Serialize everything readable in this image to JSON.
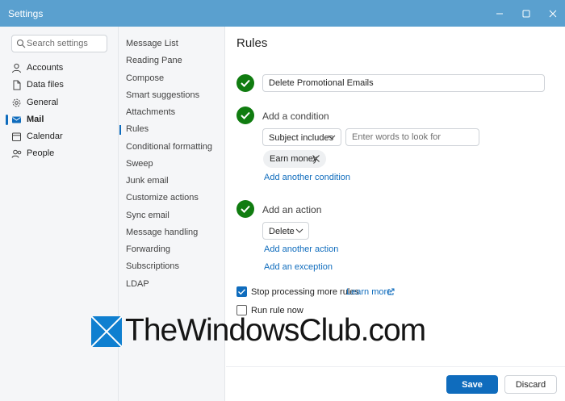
{
  "window": {
    "title": "Settings"
  },
  "search": {
    "placeholder": "Search settings"
  },
  "categories": [
    {
      "label": "Accounts",
      "icon": "person-icon"
    },
    {
      "label": "Data files",
      "icon": "document-icon"
    },
    {
      "label": "General",
      "icon": "gear-icon"
    },
    {
      "label": "Mail",
      "icon": "mail-icon",
      "active": true
    },
    {
      "label": "Calendar",
      "icon": "calendar-icon"
    },
    {
      "label": "People",
      "icon": "people-icon"
    }
  ],
  "mail_sections": [
    {
      "label": "Message List"
    },
    {
      "label": "Reading Pane"
    },
    {
      "label": "Compose"
    },
    {
      "label": "Smart suggestions"
    },
    {
      "label": "Attachments"
    },
    {
      "label": "Rules",
      "active": true
    },
    {
      "label": "Conditional formatting"
    },
    {
      "label": "Sweep"
    },
    {
      "label": "Junk email"
    },
    {
      "label": "Customize actions"
    },
    {
      "label": "Sync email"
    },
    {
      "label": "Message handling"
    },
    {
      "label": "Forwarding"
    },
    {
      "label": "Subscriptions"
    },
    {
      "label": "LDAP"
    }
  ],
  "rules": {
    "title": "Rules",
    "name_value": "Delete Promotional Emails",
    "condition": {
      "heading": "Add a condition",
      "field": "Subject includes",
      "words_placeholder": "Enter words to look for",
      "chip": "Earn money",
      "add_another": "Add another condition"
    },
    "action": {
      "heading": "Add an action",
      "value": "Delete",
      "add_another": "Add another action",
      "add_exception": "Add an exception"
    },
    "stop_processing": {
      "label": "Stop processing more rules",
      "checked": true,
      "learn_more": "Learn more"
    },
    "run_now": {
      "label": "Run rule now",
      "checked": false
    }
  },
  "footer": {
    "save": "Save",
    "discard": "Discard"
  },
  "watermark": {
    "text": "TheWindowsClub.com"
  },
  "colors": {
    "titlebar": "#5aa0cf",
    "accent": "#0f6cbd",
    "success": "#107c10"
  }
}
